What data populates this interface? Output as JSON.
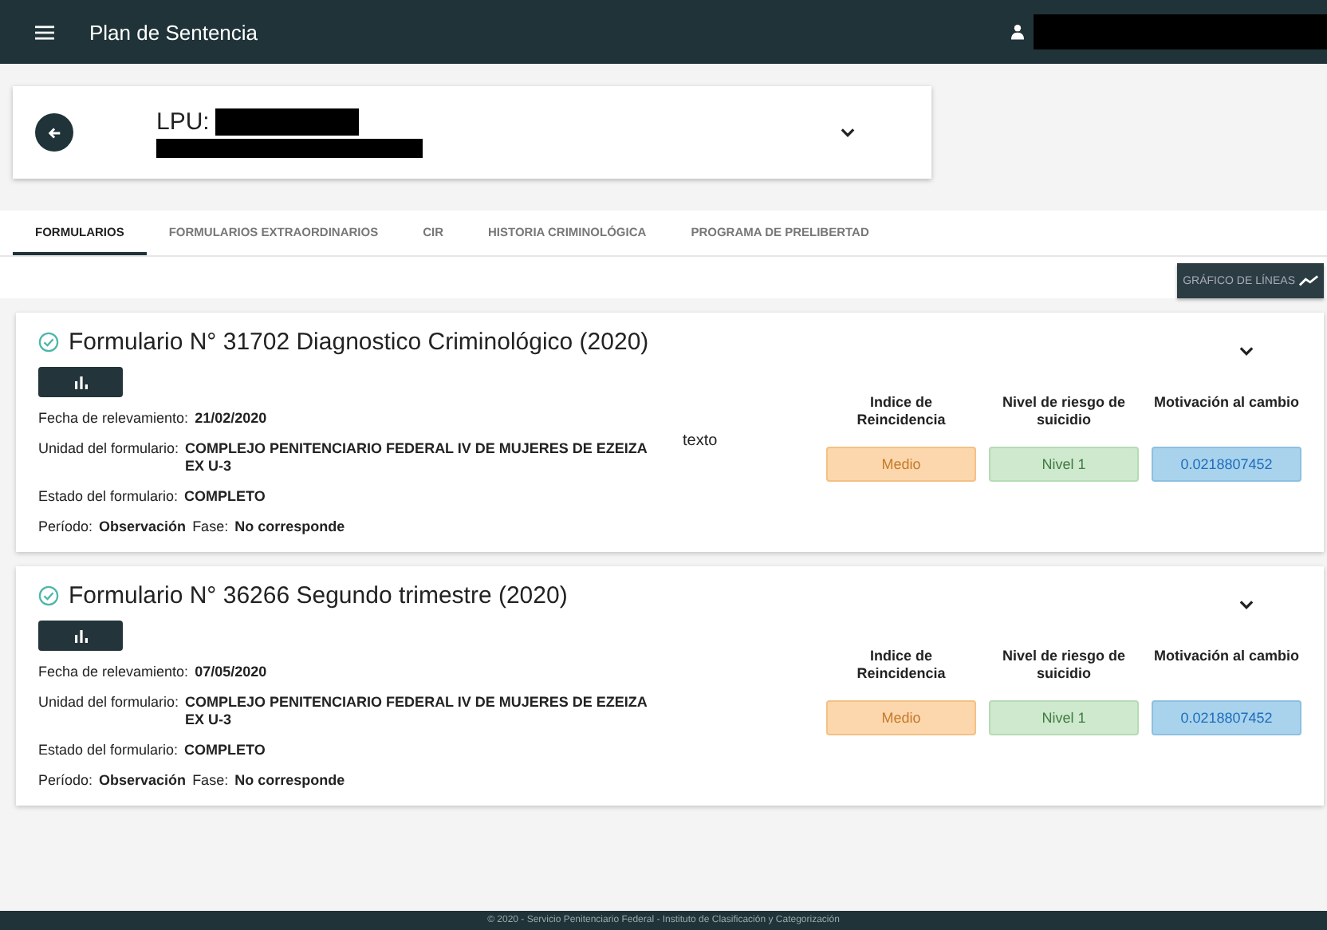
{
  "app_bar": {
    "title": "Plan de Sentencia",
    "user_redacted": true
  },
  "header": {
    "label": "LPU:",
    "redacted": true
  },
  "tabs": [
    {
      "label": "FORMULARIOS",
      "selected": true
    },
    {
      "label": "FORMULARIOS EXTRAORDINARIOS",
      "selected": false
    },
    {
      "label": "CIR",
      "selected": false
    },
    {
      "label": "HISTORIA CRIMINOLÓGICA",
      "selected": false
    },
    {
      "label": "PROGRAMA DE PRELIBERTAD",
      "selected": false
    }
  ],
  "chart_button": {
    "label": "GRÁFICO DE LÍNEAS"
  },
  "forms": [
    {
      "title": "Formulario N° 31702 Diagnostico Criminológico (2020)",
      "completed": true,
      "fields": [
        {
          "label": "Fecha de relevamiento:",
          "value": "21/02/2020"
        },
        {
          "label": "Unidad del formulario:",
          "value": "COMPLEJO PENITENCIARIO FEDERAL IV DE MUJERES DE EZEIZA EX U-3",
          "note": "texto"
        },
        {
          "label": "Estado del formulario:",
          "value": "COMPLETO"
        }
      ],
      "period": {
        "label": "Período:",
        "value": "Observación",
        "phase_label": "Fase:",
        "phase": "No corresponde"
      },
      "indicators": [
        {
          "title": "Indice de Reincidencia",
          "value": "Medio",
          "kind": "warning"
        },
        {
          "title": "Nivel de riesgo de suicidio",
          "value": "Nivel 1",
          "kind": "success"
        },
        {
          "title": "Motivación al cambio",
          "value": "0.0218807452",
          "kind": "info"
        }
      ]
    },
    {
      "title": "Formulario N° 36266 Segundo trimestre (2020)",
      "completed": true,
      "fields": [
        {
          "label": "Fecha de relevamiento:",
          "value": "07/05/2020"
        },
        {
          "label": "Unidad del formulario:",
          "value": "COMPLEJO PENITENCIARIO FEDERAL IV DE MUJERES DE EZEIZA EX U-3"
        },
        {
          "label": "Estado del formulario:",
          "value": "COMPLETO"
        }
      ],
      "period": {
        "label": "Período:",
        "value": "Observación",
        "phase_label": "Fase:",
        "phase": "No corresponde"
      },
      "indicators": [
        {
          "title": "Indice de Reincidencia",
          "value": "Medio",
          "kind": "warning"
        },
        {
          "title": "Nivel de riesgo de suicidio",
          "value": "Nivel 1",
          "kind": "success"
        },
        {
          "title": "Motivación al cambio",
          "value": "0.0218807452",
          "kind": "info"
        }
      ]
    }
  ],
  "footer": "© 2020 - Servicio Penitenciario Federal - Instituto de Clasificación y Categorización"
}
